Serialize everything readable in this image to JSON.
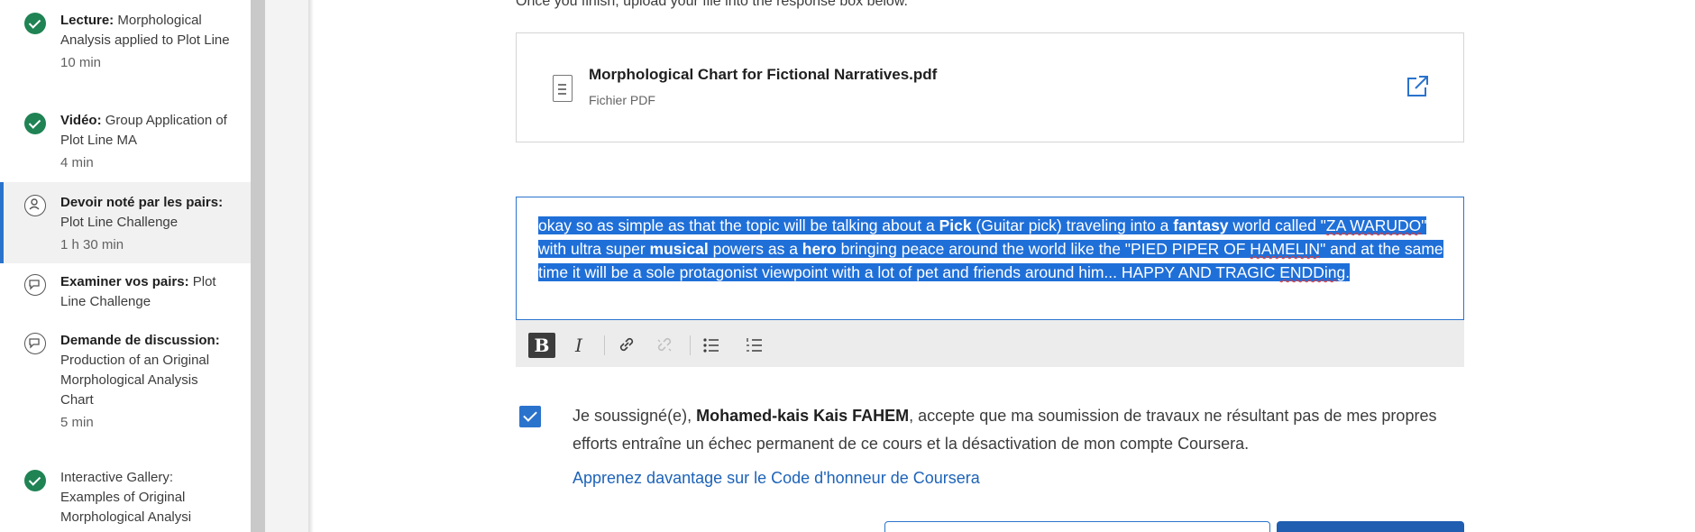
{
  "sidebar": {
    "items": [
      {
        "type": "Lecture:",
        "title": "Morphological Analysis applied to Plot Line",
        "duration": "10 min",
        "status": "completed"
      },
      {
        "type": "Vidéo:",
        "title": "Group Application of Plot Line MA",
        "duration": "4 min",
        "status": "completed"
      },
      {
        "type": "Devoir noté par les pairs:",
        "title": "Plot Line Challenge",
        "duration": "1 h 30 min",
        "status": "active"
      },
      {
        "type": "Examiner vos pairs:",
        "title": "Plot Line Challenge",
        "duration": "",
        "status": "todo"
      },
      {
        "type": "Demande de discussion:",
        "title": "Production of an Original Morphological Analysis Chart",
        "duration": "5 min",
        "status": "todo"
      },
      {
        "type": "",
        "title": "Interactive Gallery: Examples of Original Morphological Analysi",
        "duration": "",
        "status": "completed"
      }
    ]
  },
  "main": {
    "instructions": "Once you finish, upload your file into the response box below.",
    "file": {
      "name": "Morphological Chart for Fictional Narratives.pdf",
      "type": "Fichier PDF",
      "icon": "document-icon",
      "open_icon": "external-link-icon"
    },
    "editor": {
      "text_p1": "okay so as simple as that the topic will be talking about a ",
      "bold_1": "Pick",
      "text_p2": " (Guitar pick) traveling into a ",
      "bold_2": "fantasy",
      "text_p3": " world called \"",
      "sq_1": "ZA WARUDO",
      "text_p4": "\" with ultra super ",
      "bold_3": "musical",
      "text_p5": " powers as a ",
      "bold_4": "hero",
      "text_p6": " bringing peace around the world like the \"PIED PIPER OF ",
      "sq_2": "HAMELIN",
      "text_p7": "\" and at the same time it will be a sole protagonist viewpoint with a lot of pet and friends around him... HAPPY AND TRAGIC ",
      "sq_3": "ENDDing",
      "text_p8": ".",
      "selection_color": "#1f6fd8"
    },
    "toolbar": {
      "bold": "B",
      "italic": "I",
      "buttons": [
        "bold-icon",
        "italic-icon",
        "link-icon",
        "unlink-icon",
        "bulleted-list-icon",
        "numbered-list-icon"
      ]
    },
    "honor": {
      "prefix": "Je soussigné(e), ",
      "name": "Mohamed-kais Kais FAHEM",
      "suffix": ", accepte que ma soumission de travaux ne résultant pas de mes propres efforts entraîne un échec permanent de ce cours et la désactivation de mon compte Coursera.",
      "checked": true,
      "link": "Apprenez davantage sur le Code d'honneur de Coursera"
    }
  },
  "colors": {
    "accent": "#2a73cc",
    "completed": "#1f8354",
    "link": "#1d63b8"
  }
}
